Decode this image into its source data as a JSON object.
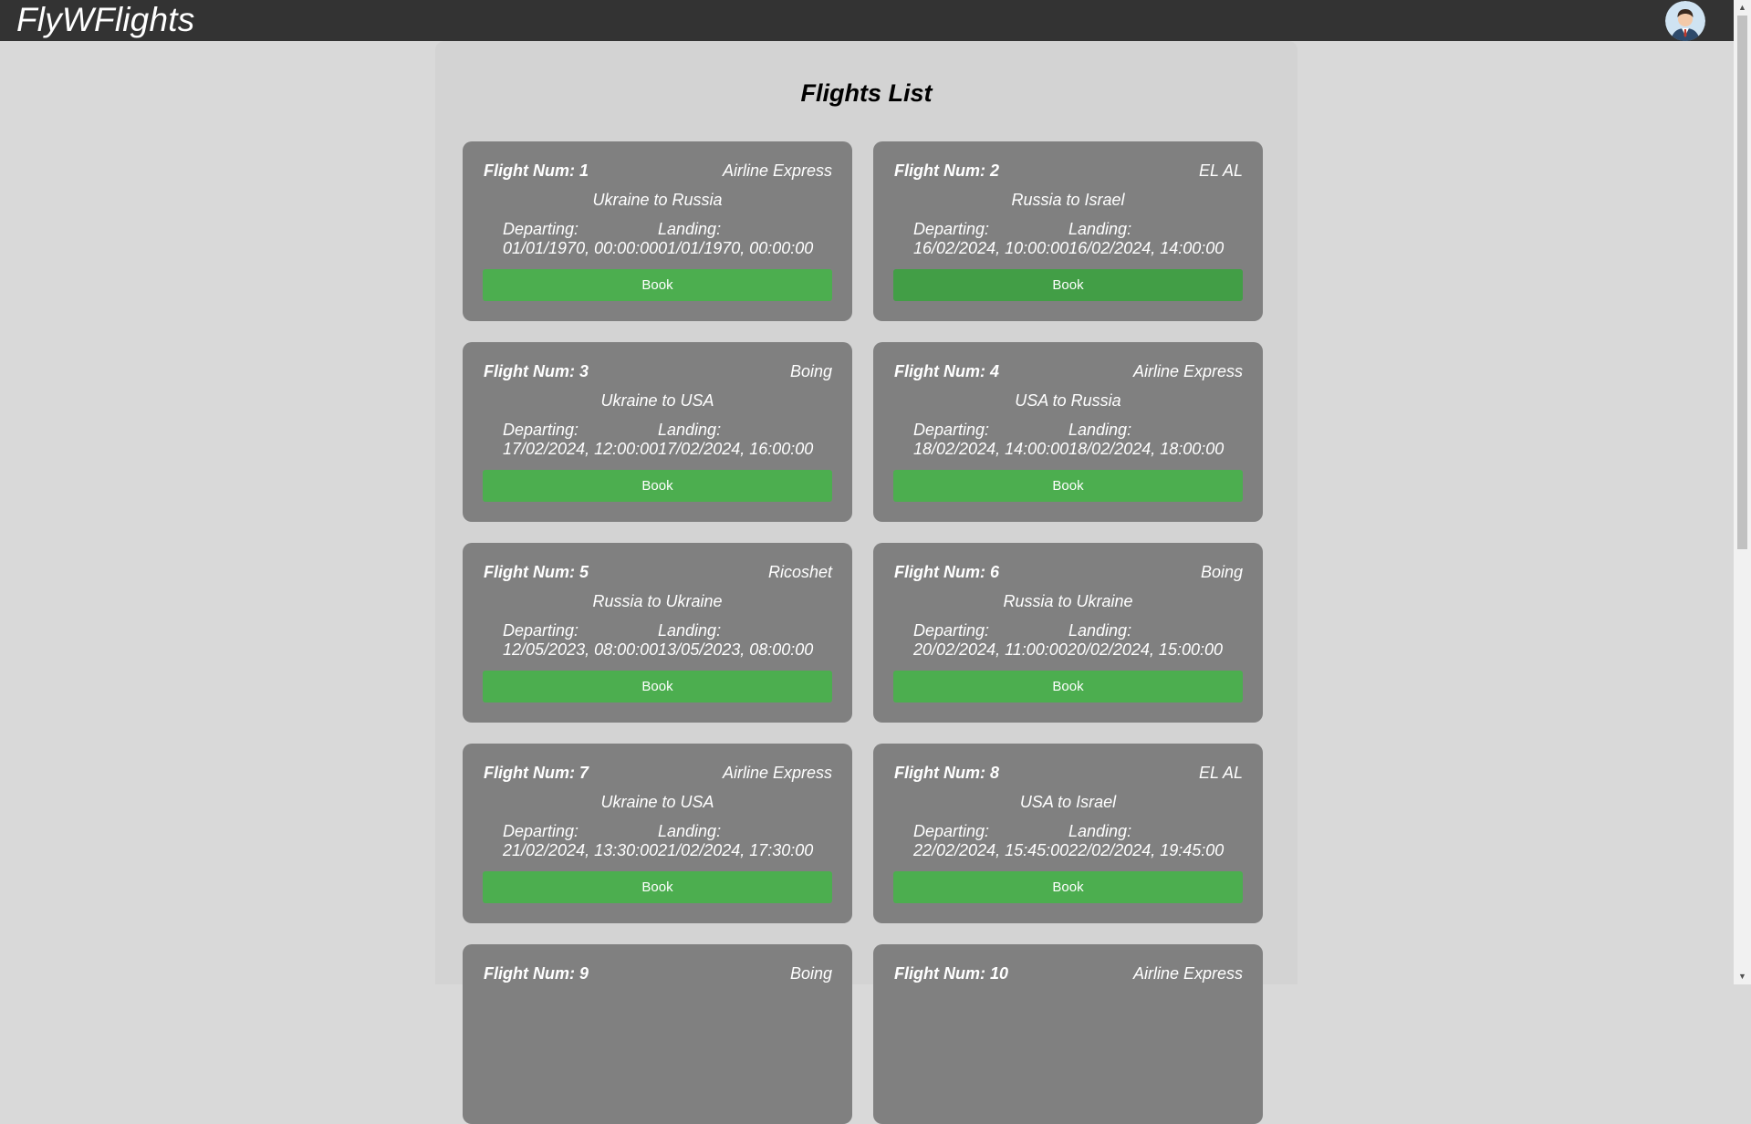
{
  "header": {
    "brand": "FlyWFlights"
  },
  "page": {
    "title": "Flights List"
  },
  "labels": {
    "departing": "Departing:",
    "landing": "Landing:"
  },
  "flights": [
    {
      "num_label": "Flight Num: 1",
      "airline": "Airline Express",
      "route": "Ukraine to Russia",
      "departing": "01/01/1970, 00:00:00",
      "landing": "01/01/1970, 00:00:00",
      "book": "Book"
    },
    {
      "num_label": "Flight Num: 2",
      "airline": "EL AL",
      "route": "Russia to Israel",
      "departing": "16/02/2024, 10:00:00",
      "landing": "16/02/2024, 14:00:00",
      "book": "Book"
    },
    {
      "num_label": "Flight Num: 3",
      "airline": "Boing",
      "route": "Ukraine to USA",
      "departing": "17/02/2024, 12:00:00",
      "landing": "17/02/2024, 16:00:00",
      "book": "Book"
    },
    {
      "num_label": "Flight Num: 4",
      "airline": "Airline Express",
      "route": "USA to Russia",
      "departing": "18/02/2024, 14:00:00",
      "landing": "18/02/2024, 18:00:00",
      "book": "Book"
    },
    {
      "num_label": "Flight Num: 5",
      "airline": "Ricoshet",
      "route": "Russia to Ukraine",
      "departing": "12/05/2023, 08:00:00",
      "landing": "13/05/2023, 08:00:00",
      "book": "Book"
    },
    {
      "num_label": "Flight Num: 6",
      "airline": "Boing",
      "route": "Russia to Ukraine",
      "departing": "20/02/2024, 11:00:00",
      "landing": "20/02/2024, 15:00:00",
      "book": "Book"
    },
    {
      "num_label": "Flight Num: 7",
      "airline": "Airline Express",
      "route": "Ukraine to USA",
      "departing": "21/02/2024, 13:30:00",
      "landing": "21/02/2024, 17:30:00",
      "book": "Book"
    },
    {
      "num_label": "Flight Num: 8",
      "airline": "EL AL",
      "route": "USA to Israel",
      "departing": "22/02/2024, 15:45:00",
      "landing": "22/02/2024, 19:45:00",
      "book": "Book"
    },
    {
      "num_label": "Flight Num: 9",
      "airline": "Boing",
      "route": "",
      "departing": "",
      "landing": "",
      "book": ""
    },
    {
      "num_label": "Flight Num: 10",
      "airline": "Airline Express",
      "route": "",
      "departing": "",
      "landing": "",
      "book": ""
    }
  ],
  "colors": {
    "topbar": "#333333",
    "card": "#808080",
    "book_button": "#4cae4f",
    "book_button_hover": "#429e46"
  }
}
